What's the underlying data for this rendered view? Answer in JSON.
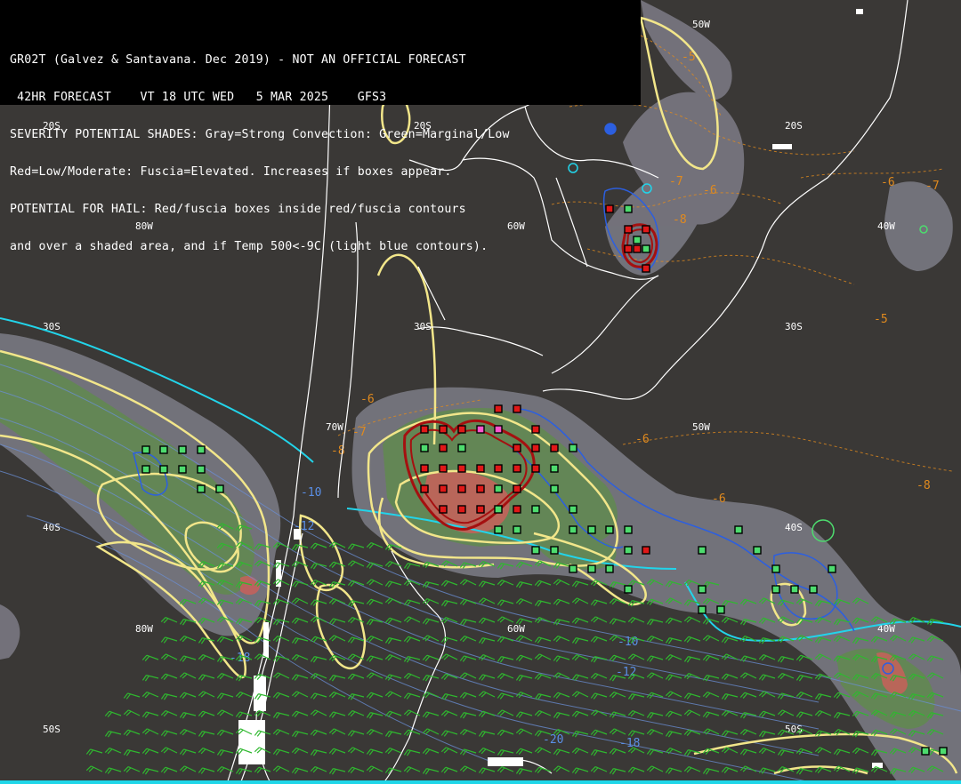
{
  "header": {
    "lines": [
      "GR02T (Galvez & Santavana. Dec 2019) - NOT AN OFFICIAL FORECAST",
      " 42HR FORECAST    VT 18 UTC WED   5 MAR 2025    GFS3",
      "SEVERITY POTENTIAL SHADES: Gray=Strong Convection: Green=Marginal/Low",
      "Red=Low/Moderate: Fuscia=Elevated. Increases if boxes appear.",
      "POTENTIAL FOR HAIL: Red/fuscia boxes inside red/fuscia contours",
      "and over a shaded area, and if Temp 500<-9C (light blue contours)."
    ]
  },
  "grid_labels": {
    "s20_a": "20S",
    "s20_b": "20S",
    "s20_c": "20S",
    "s30_a": "30S",
    "s30_b": "30S",
    "s30_c": "30S",
    "s40_a": "40S",
    "s40_b": "40S",
    "s50_a": "50S",
    "s50_b": "50S",
    "w80_a": "80W",
    "w80_b": "80W",
    "w70_a": "70W",
    "w60_a": "60W",
    "w60_b": "60W",
    "w50_a": "50W",
    "w50_b": "50W",
    "w40_a": "40W",
    "w40_b": "40W"
  },
  "temp_labels": {
    "t1": "-5",
    "t2": "-7",
    "t3": "-6",
    "t4": "-8",
    "t5": "-6",
    "t6": "-7",
    "t7": "-5",
    "t8": "-6",
    "t9": "-7",
    "t10": "-8",
    "t11": "-6",
    "t12": "-8",
    "t13": "-6"
  },
  "cold_labels": {
    "c1": "-10",
    "c2": "-12",
    "c3": "-10",
    "c4": "-12",
    "c5": "-18",
    "c6": "-20",
    "c7": "-18"
  },
  "colors": {
    "background": "#3a3836",
    "coast": "#ffffff",
    "gray_shade": "#7d7c86",
    "green_shade": "#5f8d4a",
    "red_shade": "#c8605a",
    "box_green": "#4ddc6e",
    "box_red": "#e01818",
    "box_fuscia": "#ff55cc",
    "yellow_contour": "#f2e68a",
    "red_contour": "#b01010",
    "cyan_line": "#22d4ea",
    "blue_contour": "#2c5fe0",
    "orange_temp": "#e08a1e",
    "wind_green": "#2fb82f",
    "wind_white": "#e6e6e6"
  }
}
